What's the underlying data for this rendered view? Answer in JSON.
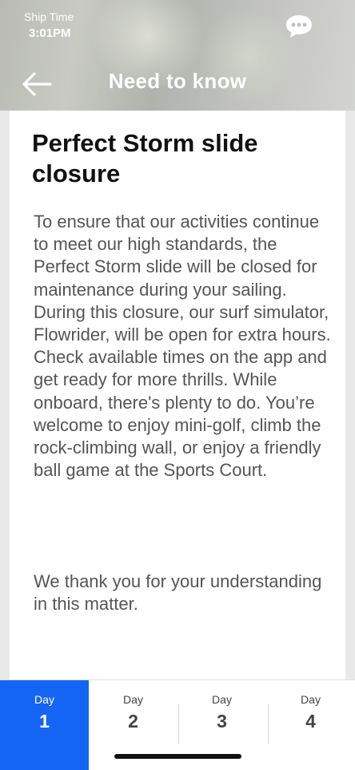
{
  "status": {
    "ship_time_label": "Ship Time",
    "ship_time_value": "3:01PM"
  },
  "header": {
    "title": "Need to know",
    "back_icon": "arrow-left-icon",
    "chat_icon": "chat-bubble-icon"
  },
  "article": {
    "title": "Perfect Storm slide closure",
    "body": "To ensure that our activities continue to meet our high standards, the Perfect Storm slide will be closed for maintenance during your sailing. During this closure, our surf simulator, Flowrider, will be open for extra hours. Check available times on the app and get ready for more thrills. While onboard, there's plenty to do. You’re welcome to enjoy mini-golf, climb the rock-climbing wall, or enjoy a friendly ball game at the Sports Court.",
    "closing": "We thank you for your understanding in this matter."
  },
  "days": [
    {
      "label": "Day",
      "number": "1",
      "active": true
    },
    {
      "label": "Day",
      "number": "2",
      "active": false
    },
    {
      "label": "Day",
      "number": "3",
      "active": false
    },
    {
      "label": "Day",
      "number": "4",
      "active": false
    }
  ],
  "colors": {
    "accent": "#1565f5",
    "title_text": "#111111",
    "body_text": "#555555"
  }
}
